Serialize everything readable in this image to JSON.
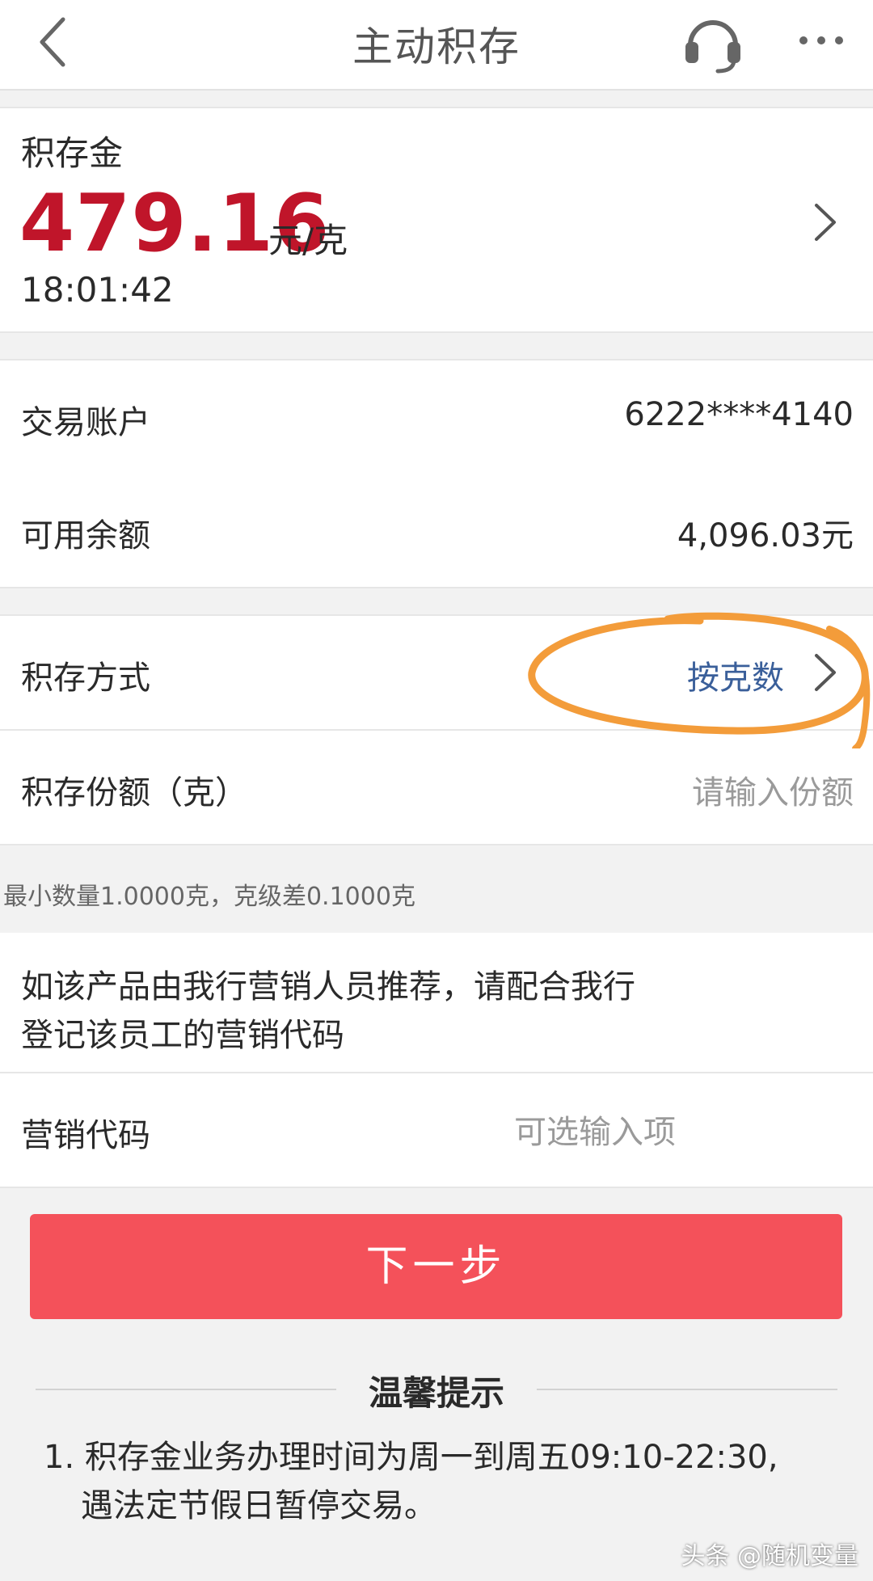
{
  "header": {
    "title": "主动积存",
    "icons": [
      "back-icon",
      "headset-icon",
      "more-icon"
    ]
  },
  "price": {
    "label": "积存金",
    "value": "479.16",
    "unit": "元/克",
    "time": "18:01:42",
    "accent_color": "#c0152a"
  },
  "account": {
    "trade_account_label": "交易账户",
    "trade_account_value": "6222****4140",
    "balance_label": "可用余额",
    "balance_value": "4,096.03元"
  },
  "method": {
    "label": "积存方式",
    "value": "按克数",
    "value_color": "#3a5f9a"
  },
  "amount": {
    "label": "积存份额（克）",
    "placeholder": "请输入份额"
  },
  "min_hint": "最小数量1.0000克，克级差0.1000克",
  "promo": {
    "line1": "如该产品由我行营销人员推荐，请配合我行",
    "line2": "登记该员工的营销代码"
  },
  "marketing": {
    "label": "营销代码",
    "placeholder": "可选输入项"
  },
  "next_button": {
    "label": "下一步",
    "color": "#f4515a"
  },
  "tips": {
    "title": "温馨提示",
    "line1": "1. 积存金业务办理时间为周一到周五09:10-22:30,",
    "line2": "遇法定节假日暂停交易。"
  },
  "watermark": "头条 @随机变量",
  "annotation_color": "#f39c3a"
}
